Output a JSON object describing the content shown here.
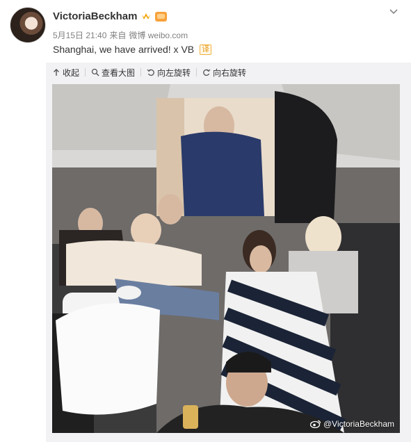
{
  "post": {
    "author": "VictoriaBeckham",
    "date": "5月15日 21:40",
    "source_prefix": "来自",
    "source": "微博 weibo.com",
    "text": "Shanghai, we have arrived! x VB",
    "translate_label": "译"
  },
  "toolbar": {
    "collapse": "收起",
    "view_large": "查看大图",
    "rotate_left": "向左旋转",
    "rotate_right": "向右旋转"
  },
  "photo": {
    "watermark": "@VictoriaBeckham"
  },
  "icons": {
    "verified": "verified-crown-icon",
    "member": "vip-member-icon",
    "menu": "chevron-down-icon",
    "collapse": "collapse-arrow-icon",
    "zoom": "magnifier-icon",
    "rotate_left": "rotate-left-icon",
    "rotate_right": "rotate-right-icon",
    "watermark_logo": "weibo-logo-icon"
  },
  "colors": {
    "text": "#333333",
    "meta": "#808080",
    "panel_bg": "#f2f2f5",
    "verified": "#f2a300",
    "translate": "#e89a16"
  }
}
